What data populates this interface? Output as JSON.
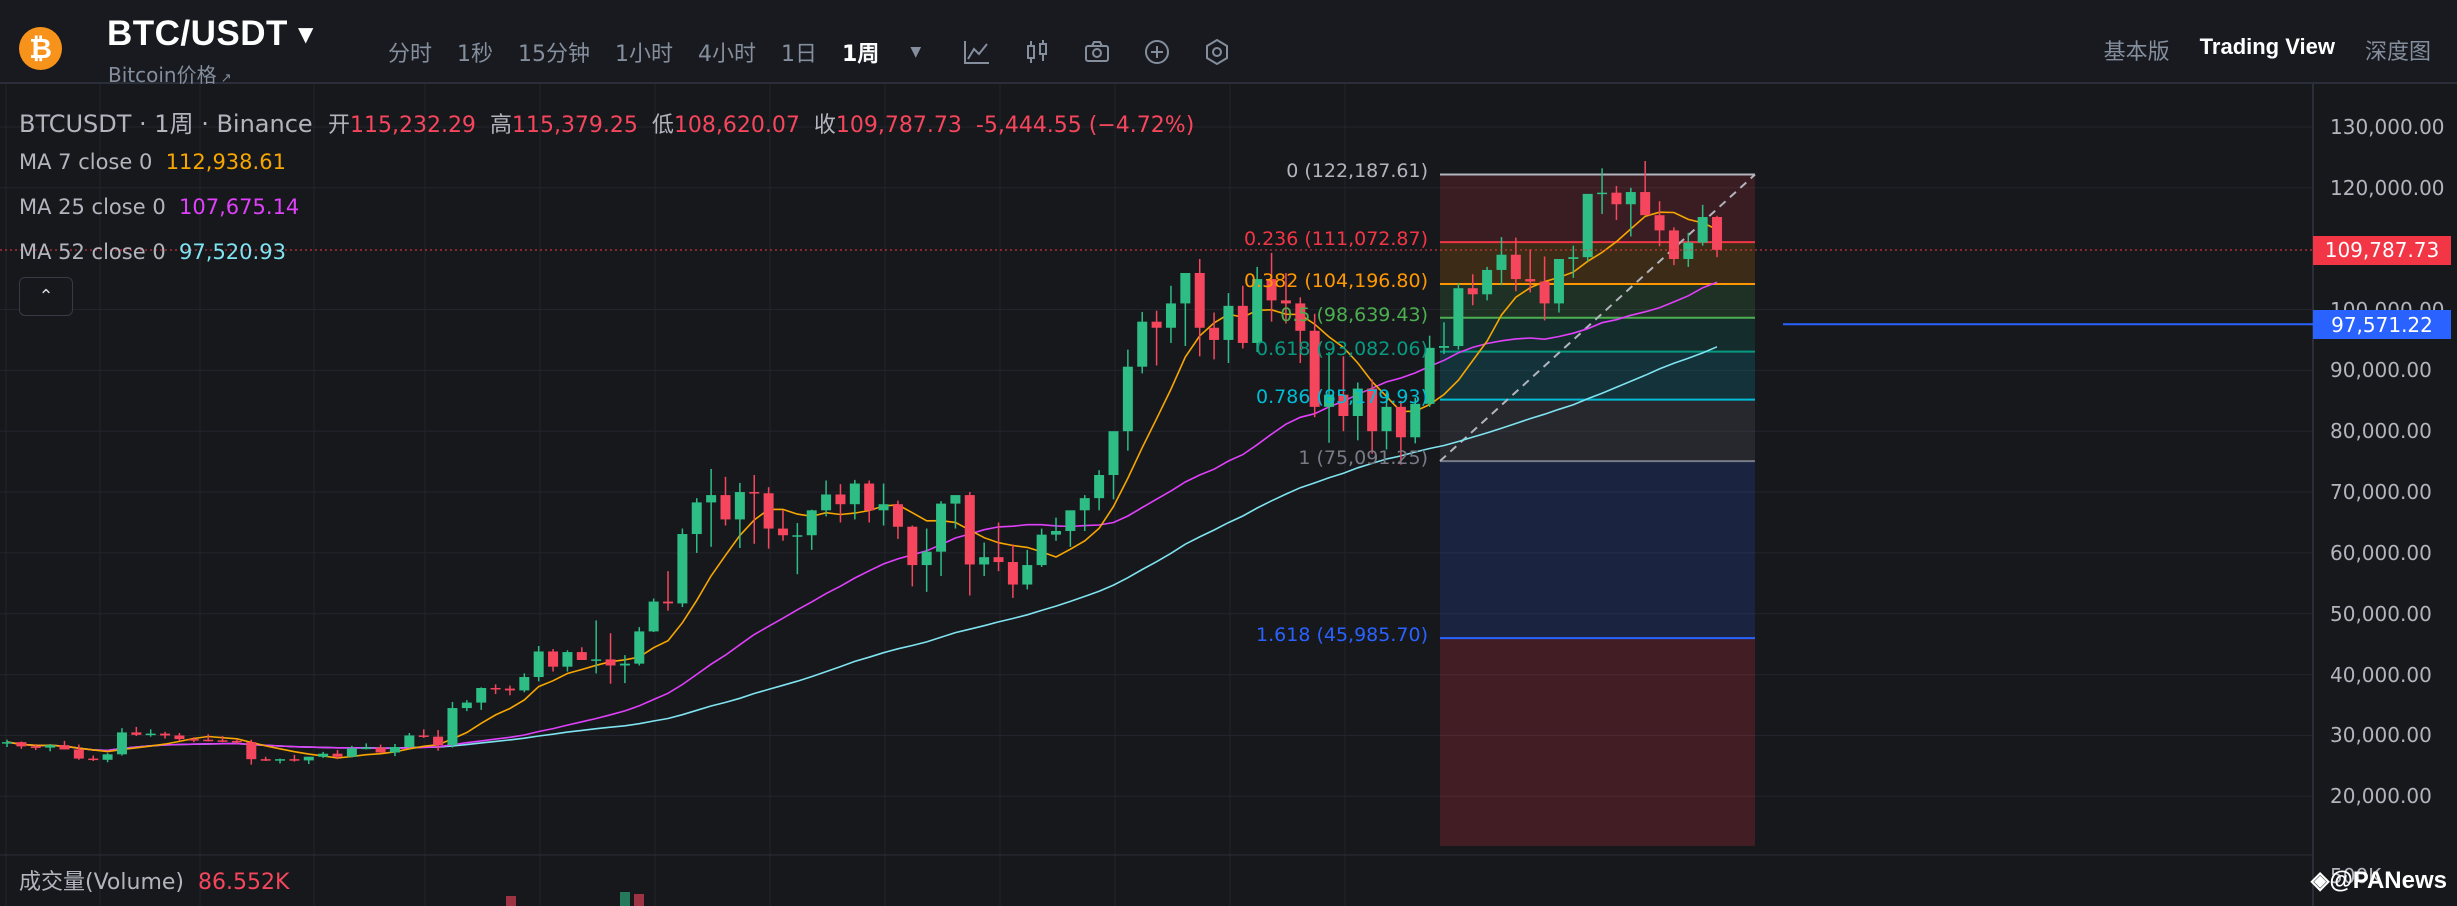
{
  "header": {
    "pair": "BTC/USDT",
    "subtitle": "Bitcoin价格",
    "subtitle_icon": "external-link-icon",
    "coin_glyph": "₿",
    "intervals": [
      "分时",
      "1秒",
      "15分钟",
      "1小时",
      "4小时",
      "1日",
      "1周"
    ],
    "active_interval": "1周",
    "tools": [
      "indicator-icon",
      "candle-type-icon",
      "camera-icon",
      "add-icon",
      "settings-icon"
    ],
    "views": [
      "基本版",
      "Trading View",
      "深度图"
    ],
    "active_view": "Trading View"
  },
  "legend": {
    "symbol": "BTCUSDT · 1周 · Binance",
    "open_label": "开",
    "open": "115,232.29",
    "high_label": "高",
    "high": "115,379.25",
    "low_label": "低",
    "low": "108,620.07",
    "close_label": "收",
    "close": "109,787.73",
    "change": "-5,444.55 (−4.72%)",
    "ma7_label": "MA 7 close 0",
    "ma7_value": "112,938.61",
    "ma25_label": "MA 25 close 0",
    "ma25_value": "107,675.14",
    "ma52_label": "MA 52 close 0",
    "ma52_value": "97,520.93",
    "collapse_glyph": "⌃"
  },
  "volume": {
    "label": "成交量(Volume)",
    "value": "86.552K"
  },
  "watermark": "◈@PANews",
  "price_axis": {
    "labels": [
      "130,000.00",
      "120,000.00",
      "100,000.00",
      "90,000.00",
      "80,000.00",
      "70,000.00",
      "60,000.00",
      "50,000.00",
      "40,000.00",
      "30,000.00",
      "20,000.00",
      "500K"
    ],
    "current_price": "109,787.73",
    "ma_tag": "97,571.22"
  },
  "fib_levels": [
    {
      "level": "0",
      "price": "122,187.61",
      "text": "0 (122,187.61)",
      "color": "#b2b5be"
    },
    {
      "level": "0.236",
      "price": "111,072.87",
      "text": "0.236 (111,072.87)",
      "color": "#f23645"
    },
    {
      "level": "0.382",
      "price": "104,196.80",
      "text": "0.382 (104,196.80)",
      "color": "#ff9800"
    },
    {
      "level": "0.5",
      "price": "98,639.43",
      "text": "0.5 (98,639.43)",
      "color": "#4caf50"
    },
    {
      "level": "0.618",
      "price": "93,082.06",
      "text": "0.618 (93,082.06)",
      "color": "#089981"
    },
    {
      "level": "0.786",
      "price": "85,179.93",
      "text": "0.786 (85,179.93)",
      "color": "#00bcd4"
    },
    {
      "level": "1",
      "price": "75,091.25",
      "text": "1 (75,091.25)",
      "color": "#787b86"
    },
    {
      "level": "1.618",
      "price": "45,985.70",
      "text": "1.618 (45,985.70)",
      "color": "#2962ff"
    }
  ],
  "chart_data": {
    "type": "candlestick",
    "interval": "1周",
    "y_range": [
      10000,
      135000
    ],
    "ohlc": [
      [
        28800,
        29300,
        28100,
        28900
      ],
      [
        28900,
        29000,
        27800,
        28200
      ],
      [
        28200,
        28600,
        27600,
        28000
      ],
      [
        28000,
        28600,
        27400,
        28400
      ],
      [
        28400,
        29100,
        27900,
        27700
      ],
      [
        27700,
        28500,
        26000,
        26200
      ],
      [
        26200,
        26700,
        25800,
        26000
      ],
      [
        26000,
        27100,
        25600,
        26900
      ],
      [
        26900,
        31200,
        26700,
        30500
      ],
      [
        30500,
        31400,
        29900,
        30100
      ],
      [
        30100,
        31000,
        29800,
        30300
      ],
      [
        30300,
        30600,
        29500,
        30000
      ],
      [
        30000,
        30400,
        29100,
        29400
      ],
      [
        29400,
        29700,
        28900,
        29300
      ],
      [
        29300,
        30200,
        29000,
        29200
      ],
      [
        29200,
        29900,
        28900,
        29100
      ],
      [
        29100,
        29400,
        28600,
        28900
      ],
      [
        28900,
        29300,
        25200,
        26100
      ],
      [
        26100,
        26500,
        25800,
        26000
      ],
      [
        26000,
        26200,
        25400,
        26100
      ],
      [
        26100,
        26800,
        25700,
        25900
      ],
      [
        25900,
        26500,
        25300,
        26500
      ],
      [
        26500,
        27300,
        26300,
        27000
      ],
      [
        27000,
        27600,
        26100,
        26500
      ],
      [
        26500,
        28300,
        26400,
        27900
      ],
      [
        27900,
        28700,
        27700,
        28000
      ],
      [
        28000,
        28500,
        27100,
        27200
      ],
      [
        27200,
        28600,
        26600,
        28100
      ],
      [
        28100,
        30400,
        27900,
        30000
      ],
      [
        30000,
        31000,
        29600,
        29800
      ],
      [
        29800,
        30900,
        27500,
        28400
      ],
      [
        28400,
        35500,
        28000,
        34500
      ],
      [
        34500,
        35800,
        34000,
        35400
      ],
      [
        35400,
        37900,
        34200,
        37800
      ],
      [
        37800,
        38400,
        36800,
        37700
      ],
      [
        37700,
        38200,
        36600,
        37400
      ],
      [
        37400,
        40200,
        37100,
        39600
      ],
      [
        39600,
        44700,
        38900,
        43800
      ],
      [
        43800,
        44200,
        40500,
        41300
      ],
      [
        41300,
        44000,
        40500,
        43700
      ],
      [
        43700,
        44500,
        42800,
        42400
      ],
      [
        42400,
        48900,
        40200,
        42500
      ],
      [
        42500,
        46800,
        38500,
        41500
      ],
      [
        41500,
        43200,
        38600,
        41800
      ],
      [
        41800,
        47800,
        41500,
        47100
      ],
      [
        47100,
        52500,
        47000,
        52000
      ],
      [
        52000,
        57000,
        50500,
        51700
      ],
      [
        51700,
        64000,
        51100,
        63100
      ],
      [
        63100,
        69000,
        60000,
        68300
      ],
      [
        68300,
        73800,
        61000,
        69500
      ],
      [
        69500,
        72500,
        64500,
        65500
      ],
      [
        65500,
        71500,
        60800,
        70000
      ],
      [
        70000,
        72800,
        61500,
        69800
      ],
      [
        69800,
        70800,
        60700,
        64000
      ],
      [
        64000,
        67000,
        62000,
        62900
      ],
      [
        62900,
        64900,
        56500,
        62900
      ],
      [
        62900,
        67100,
        60500,
        67000
      ],
      [
        67000,
        71900,
        66000,
        69600
      ],
      [
        69600,
        71300,
        65000,
        68000
      ],
      [
        68000,
        72000,
        65500,
        71400
      ],
      [
        71400,
        71900,
        65000,
        67000
      ],
      [
        67000,
        71400,
        64500,
        68000
      ],
      [
        68000,
        68600,
        62300,
        64300
      ],
      [
        64300,
        64500,
        54500,
        58000
      ],
      [
        58000,
        64000,
        53600,
        60200
      ],
      [
        60200,
        68500,
        56200,
        68100
      ],
      [
        68100,
        69400,
        64000,
        69500
      ],
      [
        69500,
        70000,
        53000,
        58100
      ],
      [
        58100,
        61700,
        56200,
        59300
      ],
      [
        59300,
        65000,
        57000,
        58500
      ],
      [
        58500,
        61400,
        52600,
        54800
      ],
      [
        54800,
        60500,
        54000,
        58000
      ],
      [
        58000,
        64000,
        57700,
        63000
      ],
      [
        63000,
        65800,
        62000,
        63600
      ],
      [
        63600,
        66500,
        61000,
        67000
      ],
      [
        67000,
        69500,
        63600,
        69000
      ],
      [
        69000,
        73600,
        67000,
        72800
      ],
      [
        72800,
        77000,
        68800,
        80000
      ],
      [
        80000,
        93400,
        76800,
        90600
      ],
      [
        90600,
        99600,
        89500,
        98000
      ],
      [
        98000,
        99800,
        90800,
        97000
      ],
      [
        97000,
        103900,
        94500,
        101000
      ],
      [
        101000,
        104000,
        94000,
        106000
      ],
      [
        106000,
        108300,
        92300,
        97000
      ],
      [
        97000,
        99500,
        91800,
        95000
      ],
      [
        95000,
        102700,
        91200,
        100600
      ],
      [
        100600,
        103900,
        93600,
        94500
      ],
      [
        94500,
        107000,
        93000,
        105000
      ],
      [
        105000,
        109300,
        98000,
        101500
      ],
      [
        101500,
        106000,
        97700,
        101000
      ],
      [
        101000,
        102000,
        91200,
        96500
      ],
      [
        96500,
        99300,
        82300,
        84000
      ],
      [
        84000,
        93000,
        78100,
        86000
      ],
      [
        86000,
        92300,
        80000,
        82500
      ],
      [
        82500,
        88000,
        78500,
        87000
      ],
      [
        87000,
        88500,
        76300,
        80000
      ],
      [
        80000,
        86400,
        77000,
        84000
      ],
      [
        84000,
        85000,
        74500,
        79000
      ],
      [
        79000,
        85500,
        78000,
        84500
      ],
      [
        84500,
        95700,
        84000,
        93700
      ],
      [
        93700,
        97900,
        92700,
        94000
      ],
      [
        94000,
        104300,
        93400,
        103500
      ],
      [
        103500,
        105800,
        100700,
        102500
      ],
      [
        102500,
        107000,
        101500,
        106500
      ],
      [
        106500,
        111900,
        104000,
        109000
      ],
      [
        109000,
        111800,
        103000,
        105000
      ],
      [
        105000,
        109900,
        102800,
        104600
      ],
      [
        104600,
        108700,
        98200,
        101000
      ],
      [
        101000,
        106500,
        99500,
        108300
      ],
      [
        108300,
        110500,
        105200,
        108600
      ],
      [
        108600,
        118900,
        107900,
        119000
      ],
      [
        119000,
        123200,
        115700,
        119200
      ],
      [
        119200,
        120300,
        114700,
        117300
      ],
      [
        117300,
        120000,
        112000,
        119300
      ],
      [
        119300,
        124400,
        117200,
        115500
      ],
      [
        115500,
        117800,
        110400,
        113000
      ],
      [
        113000,
        113500,
        107300,
        108300
      ],
      [
        108300,
        112600,
        107000,
        111000
      ],
      [
        111000,
        117200,
        110500,
        115200
      ],
      [
        115200,
        115400,
        108600,
        109800
      ]
    ]
  }
}
